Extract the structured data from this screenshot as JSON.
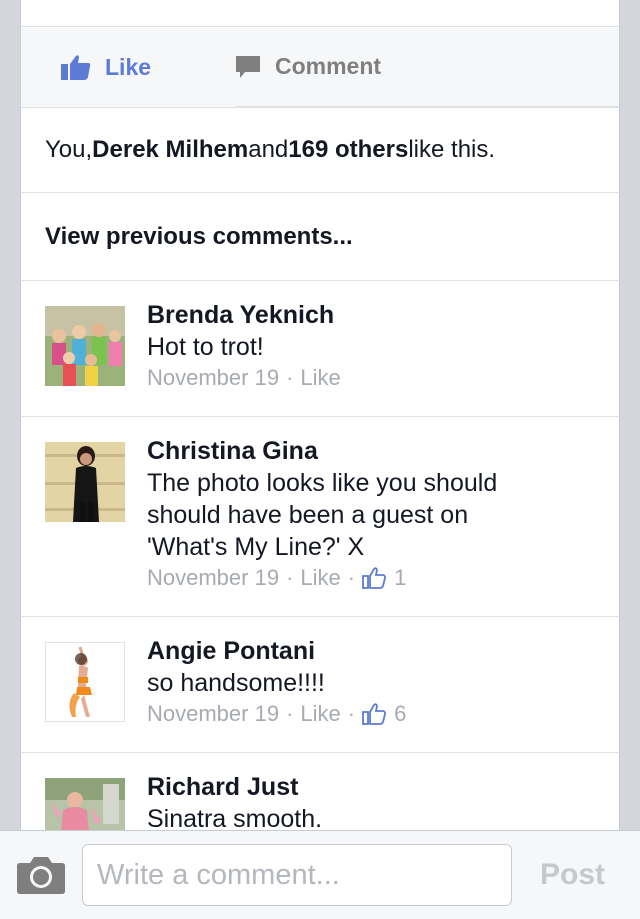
{
  "actions": {
    "like_label": "Like",
    "comment_label": "Comment"
  },
  "likes": {
    "prefix": "You, ",
    "friend": "Derek Milhem",
    "middle": " and ",
    "others": "169 others",
    "suffix": " like this."
  },
  "view_previous": "View previous comments...",
  "comments": [
    {
      "name": "Brenda Yeknich",
      "lines": [
        "Hot to trot!"
      ],
      "date": "November 19",
      "like_label": "Like",
      "like_count": null
    },
    {
      "name": "Christina Gina",
      "lines": [
        "The photo looks like you should",
        "should have been a guest on",
        "'What's My Line?' X"
      ],
      "date": "November 19",
      "like_label": "Like",
      "like_count": "1"
    },
    {
      "name": "Angie Pontani",
      "lines": [
        "so handsome!!!!"
      ],
      "date": "November 19",
      "like_label": "Like",
      "like_count": "6"
    },
    {
      "name": "Richard Just",
      "lines": [
        "Sinatra smooth."
      ],
      "date": "",
      "like_label": "",
      "like_count": null
    }
  ],
  "composer": {
    "placeholder": "Write a comment...",
    "post_label": "Post"
  },
  "colors": {
    "accent": "#5b7bd5",
    "meta": "#a7abb1",
    "text": "#141823"
  }
}
